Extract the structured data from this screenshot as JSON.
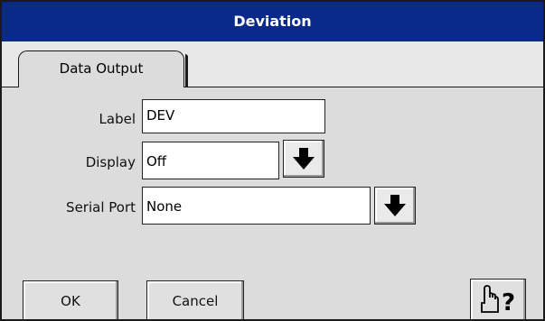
{
  "window": {
    "title": "Deviation"
  },
  "tabs": [
    {
      "label": "Data Output"
    }
  ],
  "form": {
    "label": {
      "caption": "Label",
      "value": "DEV"
    },
    "display": {
      "caption": "Display",
      "value": "Off",
      "dropdown_icon": "arrow-down-icon"
    },
    "serial_port": {
      "caption": "Serial Port",
      "value": "None",
      "dropdown_icon": "arrow-down-icon"
    }
  },
  "buttons": {
    "ok": "OK",
    "cancel": "Cancel",
    "help_icon": "hand-question-icon"
  },
  "colors": {
    "titlebar": "#0a2a8a",
    "background": "#dcdcdc"
  }
}
